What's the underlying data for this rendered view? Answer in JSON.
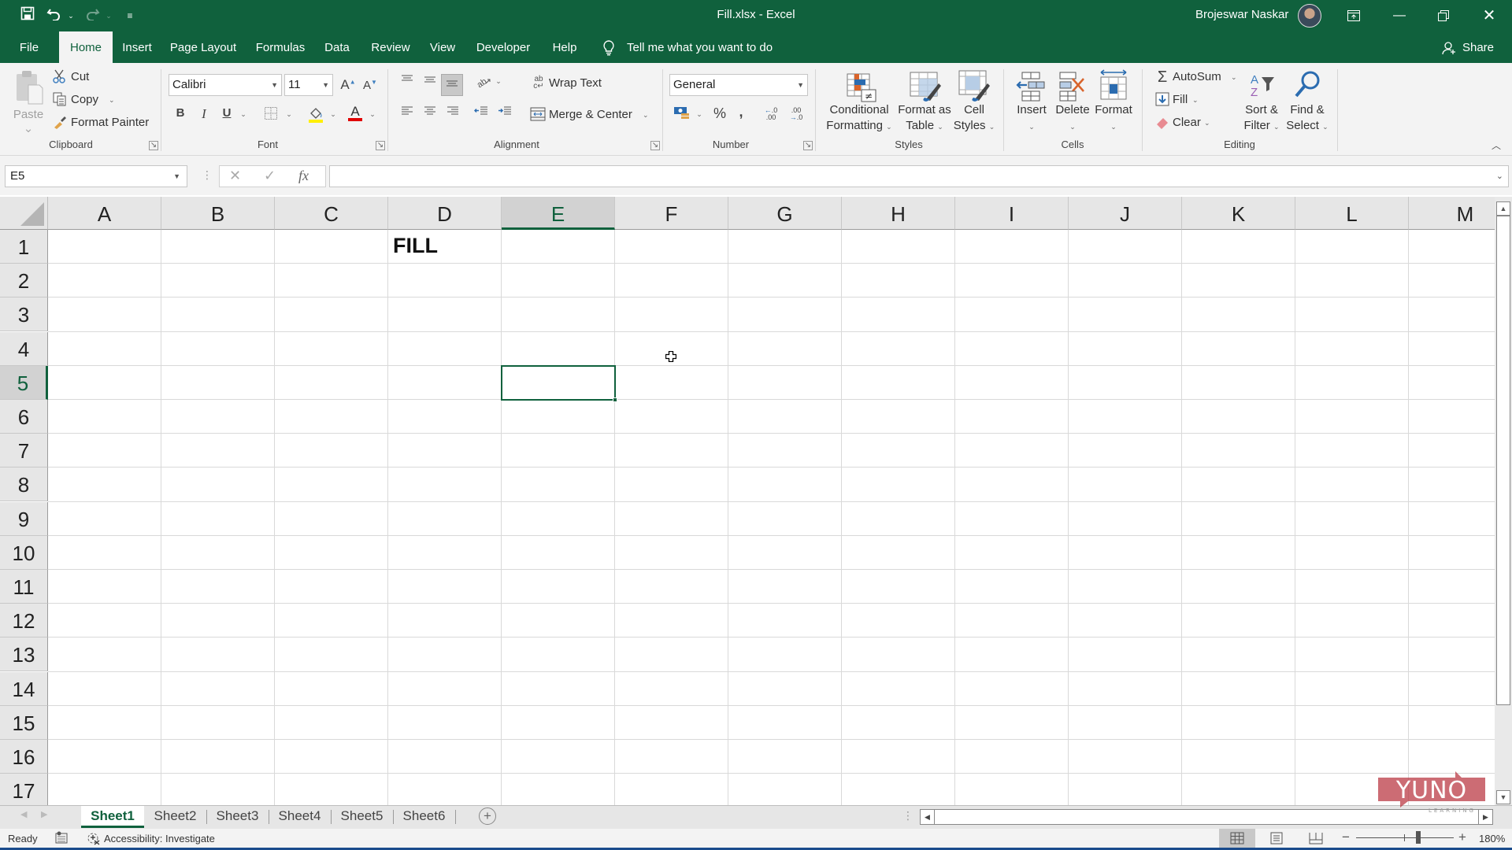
{
  "window": {
    "title": "Fill.xlsx  -  Excel",
    "user_name": "Brojeswar Naskar",
    "share_label": "Share",
    "tell_me": "Tell me what you want to do",
    "colors": {
      "brand": "#10613d",
      "ribbon_bg": "#f3f3f3",
      "header_bg": "#e6e6e6"
    }
  },
  "quick_access": {
    "save": "save-icon",
    "undo": "undo-icon",
    "redo": "redo-icon",
    "customize": "customize-qat-icon"
  },
  "tabs": [
    {
      "label": "File"
    },
    {
      "label": "Home",
      "active": true
    },
    {
      "label": "Insert"
    },
    {
      "label": "Page Layout"
    },
    {
      "label": "Formulas"
    },
    {
      "label": "Data"
    },
    {
      "label": "Review"
    },
    {
      "label": "View"
    },
    {
      "label": "Developer"
    },
    {
      "label": "Help"
    }
  ],
  "ribbon": {
    "clipboard": {
      "label": "Clipboard",
      "paste": "Paste",
      "cut": "Cut",
      "copy": "Copy",
      "format_painter": "Format Painter"
    },
    "font": {
      "label": "Font",
      "font_name": "Calibri",
      "font_size": "11",
      "bold": "B",
      "italic": "I",
      "underline": "U"
    },
    "alignment": {
      "label": "Alignment",
      "wrap_text": "Wrap Text",
      "merge_center": "Merge & Center"
    },
    "number": {
      "label": "Number",
      "format": "General",
      "percent": "%",
      "comma": ",",
      "inc_decimal": "←.0 .00",
      "dec_decimal": ".00 →.0"
    },
    "styles": {
      "label": "Styles",
      "conditional_formatting": [
        "Conditional",
        "Formatting"
      ],
      "format_as_table": [
        "Format as",
        "Table"
      ],
      "cell_styles": [
        "Cell",
        "Styles"
      ]
    },
    "cells": {
      "label": "Cells",
      "insert": "Insert",
      "delete": "Delete",
      "format": "Format"
    },
    "editing": {
      "label": "Editing",
      "autosum": "AutoSum",
      "fill": "Fill",
      "clear": "Clear",
      "sort_filter": [
        "Sort &",
        "Filter"
      ],
      "find_select": [
        "Find &",
        "Select"
      ]
    }
  },
  "formula_bar": {
    "name_box": "E5",
    "formula": ""
  },
  "sheet": {
    "columns": [
      "A",
      "B",
      "C",
      "D",
      "E",
      "F",
      "G",
      "H",
      "I",
      "J",
      "K",
      "L",
      "M"
    ],
    "rows": [
      "1",
      "2",
      "3",
      "4",
      "5",
      "6",
      "7",
      "8",
      "9",
      "10",
      "11",
      "12",
      "13",
      "14",
      "15",
      "16",
      "17"
    ],
    "selected_column": "E",
    "selected_row": "5",
    "cells": [
      {
        "ref": "D1",
        "value": "FILL",
        "bold": true
      }
    ],
    "active_cell": "E5"
  },
  "sheet_tabs": [
    {
      "label": "Sheet1",
      "active": true
    },
    {
      "label": "Sheet2"
    },
    {
      "label": "Sheet3"
    },
    {
      "label": "Sheet4"
    },
    {
      "label": "Sheet5"
    },
    {
      "label": "Sheet6"
    }
  ],
  "status_bar": {
    "ready": "Ready",
    "accessibility": "Accessibility: Investigate",
    "zoom_level": "180%",
    "zoom_minus": "−",
    "zoom_plus": "+"
  },
  "watermark": {
    "brand": "YUNO",
    "sub": "LEARNING"
  }
}
